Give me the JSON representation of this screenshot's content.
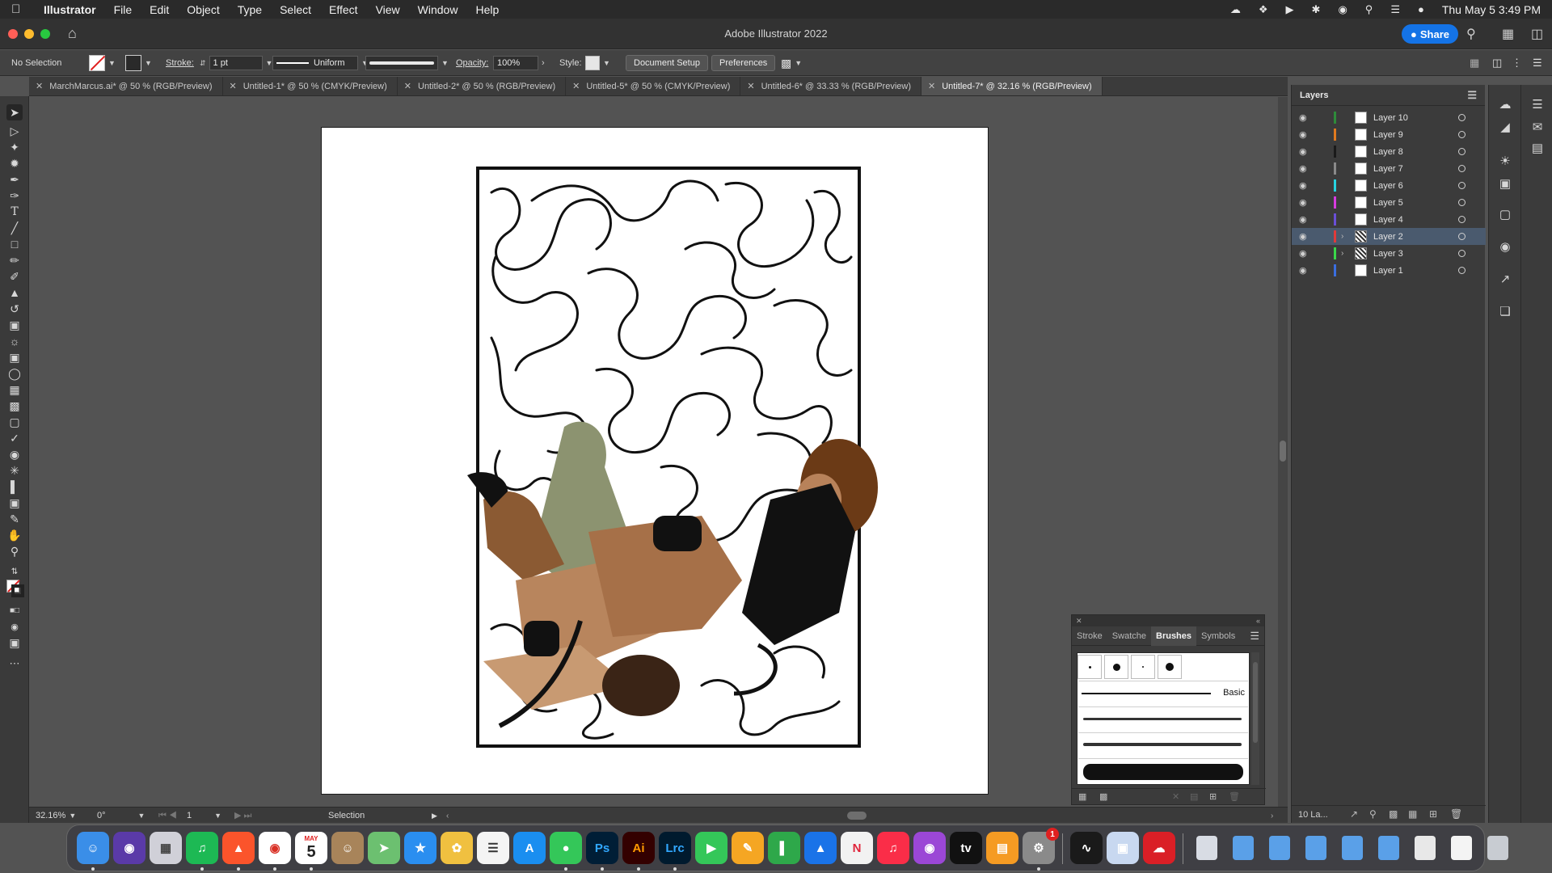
{
  "menubar": {
    "app_name": "Illustrator",
    "items": [
      "File",
      "Edit",
      "Object",
      "Type",
      "Select",
      "Effect",
      "View",
      "Window",
      "Help"
    ],
    "datetime": "Thu May 5  3:49 PM"
  },
  "window": {
    "title": "Adobe Illustrator 2022",
    "share_label": "Share"
  },
  "control_bar": {
    "selection_label": "No Selection",
    "stroke_label": "Stroke:",
    "stroke_weight": "1 pt",
    "stroke_profile": "Uniform",
    "opacity_label": "Opacity:",
    "opacity_value": "100%",
    "style_label": "Style:",
    "document_setup": "Document Setup",
    "preferences": "Preferences"
  },
  "tabs": [
    {
      "label": "MarchMarcus.ai* @ 50 % (RGB/Preview)",
      "active": false
    },
    {
      "label": "Untitled-1* @ 50 % (CMYK/Preview)",
      "active": false
    },
    {
      "label": "Untitled-2* @ 50 % (RGB/Preview)",
      "active": false
    },
    {
      "label": "Untitled-5* @ 50 % (CMYK/Preview)",
      "active": false
    },
    {
      "label": "Untitled-6* @ 33.33 % (RGB/Preview)",
      "active": false
    },
    {
      "label": "Untitled-7* @ 32.16 % (RGB/Preview)",
      "active": true
    }
  ],
  "layers_panel": {
    "title": "Layers",
    "layers": [
      {
        "name": "Layer 10",
        "color": "#2e8b3a",
        "expandable": false,
        "art": false,
        "selected": false
      },
      {
        "name": "Layer 9",
        "color": "#e07a1f",
        "expandable": false,
        "art": false,
        "selected": false
      },
      {
        "name": "Layer 8",
        "color": "#1a1a1a",
        "expandable": false,
        "art": false,
        "selected": false
      },
      {
        "name": "Layer 7",
        "color": "#8a8a8a",
        "expandable": false,
        "art": false,
        "selected": false
      },
      {
        "name": "Layer 6",
        "color": "#27d3e0",
        "expandable": false,
        "art": false,
        "selected": false
      },
      {
        "name": "Layer 5",
        "color": "#d83be0",
        "expandable": false,
        "art": false,
        "selected": false
      },
      {
        "name": "Layer 4",
        "color": "#6a4fd8",
        "expandable": false,
        "art": false,
        "selected": false
      },
      {
        "name": "Layer 2",
        "color": "#e03a3a",
        "expandable": true,
        "art": true,
        "selected": true
      },
      {
        "name": "Layer 3",
        "color": "#3ad84a",
        "expandable": true,
        "art": true,
        "selected": false
      },
      {
        "name": "Layer 1",
        "color": "#3a6ee0",
        "expandable": false,
        "art": false,
        "selected": false
      }
    ],
    "footer_count": "10 La..."
  },
  "brushes_panel": {
    "tabs": [
      "Stroke",
      "Swatche",
      "Brushes",
      "Symbols"
    ],
    "active_tab": "Brushes",
    "basic_label": "Basic"
  },
  "status_bar": {
    "zoom": "32.16%",
    "rotation": "0°",
    "artboard_number": "1",
    "tool_name": "Selection"
  },
  "dock": {
    "apps": [
      "Finder",
      "Siri",
      "Launchpad",
      "Spotify",
      "Brave",
      "Chrome",
      "Calendar",
      "Contacts",
      "Maps",
      "Safari",
      "Photos",
      "Reminders",
      "App Store",
      "Messages",
      "Ps",
      "Ai",
      "Lrc",
      "FaceTime",
      "Pages",
      "Numbers",
      "Keynote",
      "News",
      "Music",
      "Podcasts",
      "tv",
      "Books",
      "System Preferences"
    ],
    "calendar_month": "MAY",
    "calendar_day": "5",
    "system_prefs_badge": "1"
  }
}
